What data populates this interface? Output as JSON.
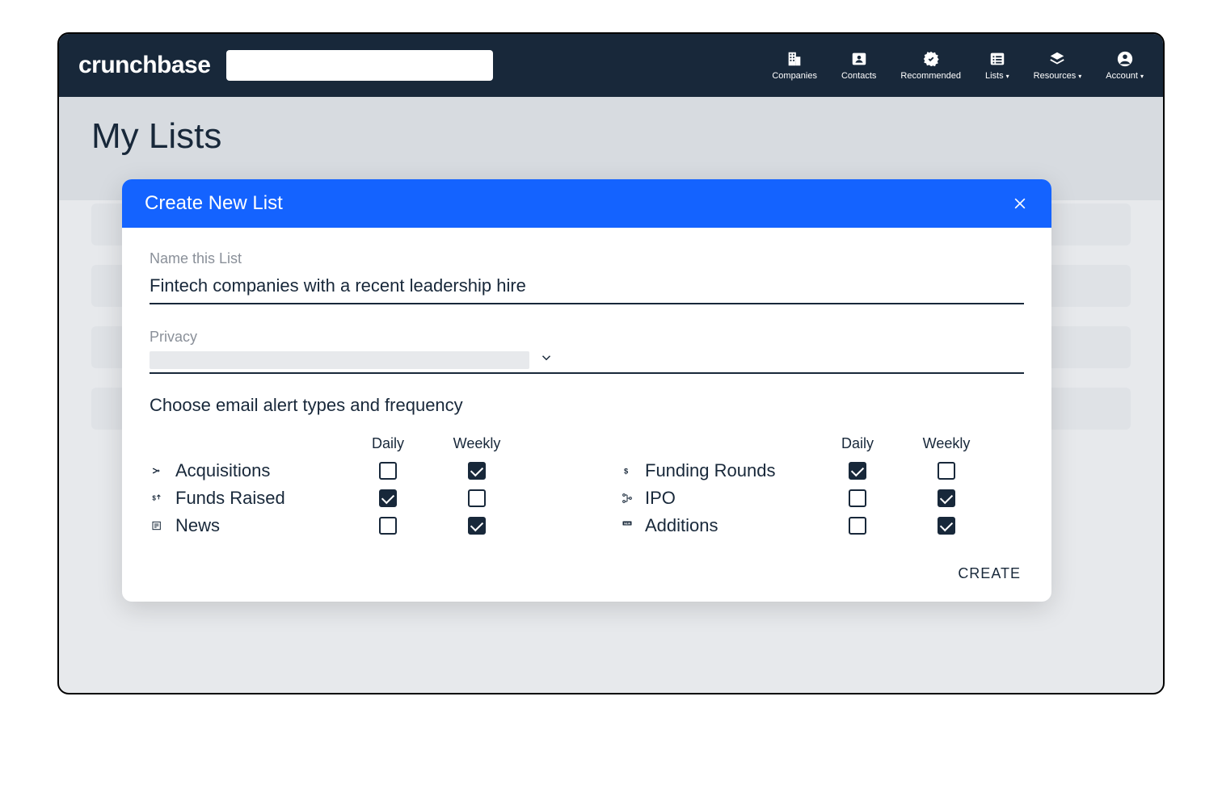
{
  "brand": "crunchbase",
  "nav": {
    "companies": "Companies",
    "contacts": "Contacts",
    "recommended": "Recommended",
    "lists": "Lists",
    "resources": "Resources",
    "account": "Account"
  },
  "page": {
    "title": "My Lists"
  },
  "modal": {
    "title": "Create New List",
    "name_label": "Name this List",
    "name_value": "Fintech companies with a recent leadership hire",
    "privacy_label": "Privacy",
    "alerts_heading": "Choose email alert types and frequency",
    "freq_daily": "Daily",
    "freq_weekly": "Weekly",
    "create_label": "CREATE",
    "alerts_left": [
      {
        "label": "Acquisitions",
        "icon": "merge",
        "daily": false,
        "weekly": true
      },
      {
        "label": "Funds Raised",
        "icon": "dollar-up",
        "daily": true,
        "weekly": false
      },
      {
        "label": "News",
        "icon": "news",
        "daily": false,
        "weekly": true
      }
    ],
    "alerts_right": [
      {
        "label": "Funding Rounds",
        "icon": "dollar",
        "daily": true,
        "weekly": false
      },
      {
        "label": "IPO",
        "icon": "ipo",
        "daily": false,
        "weekly": true
      },
      {
        "label": "Additions",
        "icon": "new",
        "daily": false,
        "weekly": true
      }
    ]
  }
}
